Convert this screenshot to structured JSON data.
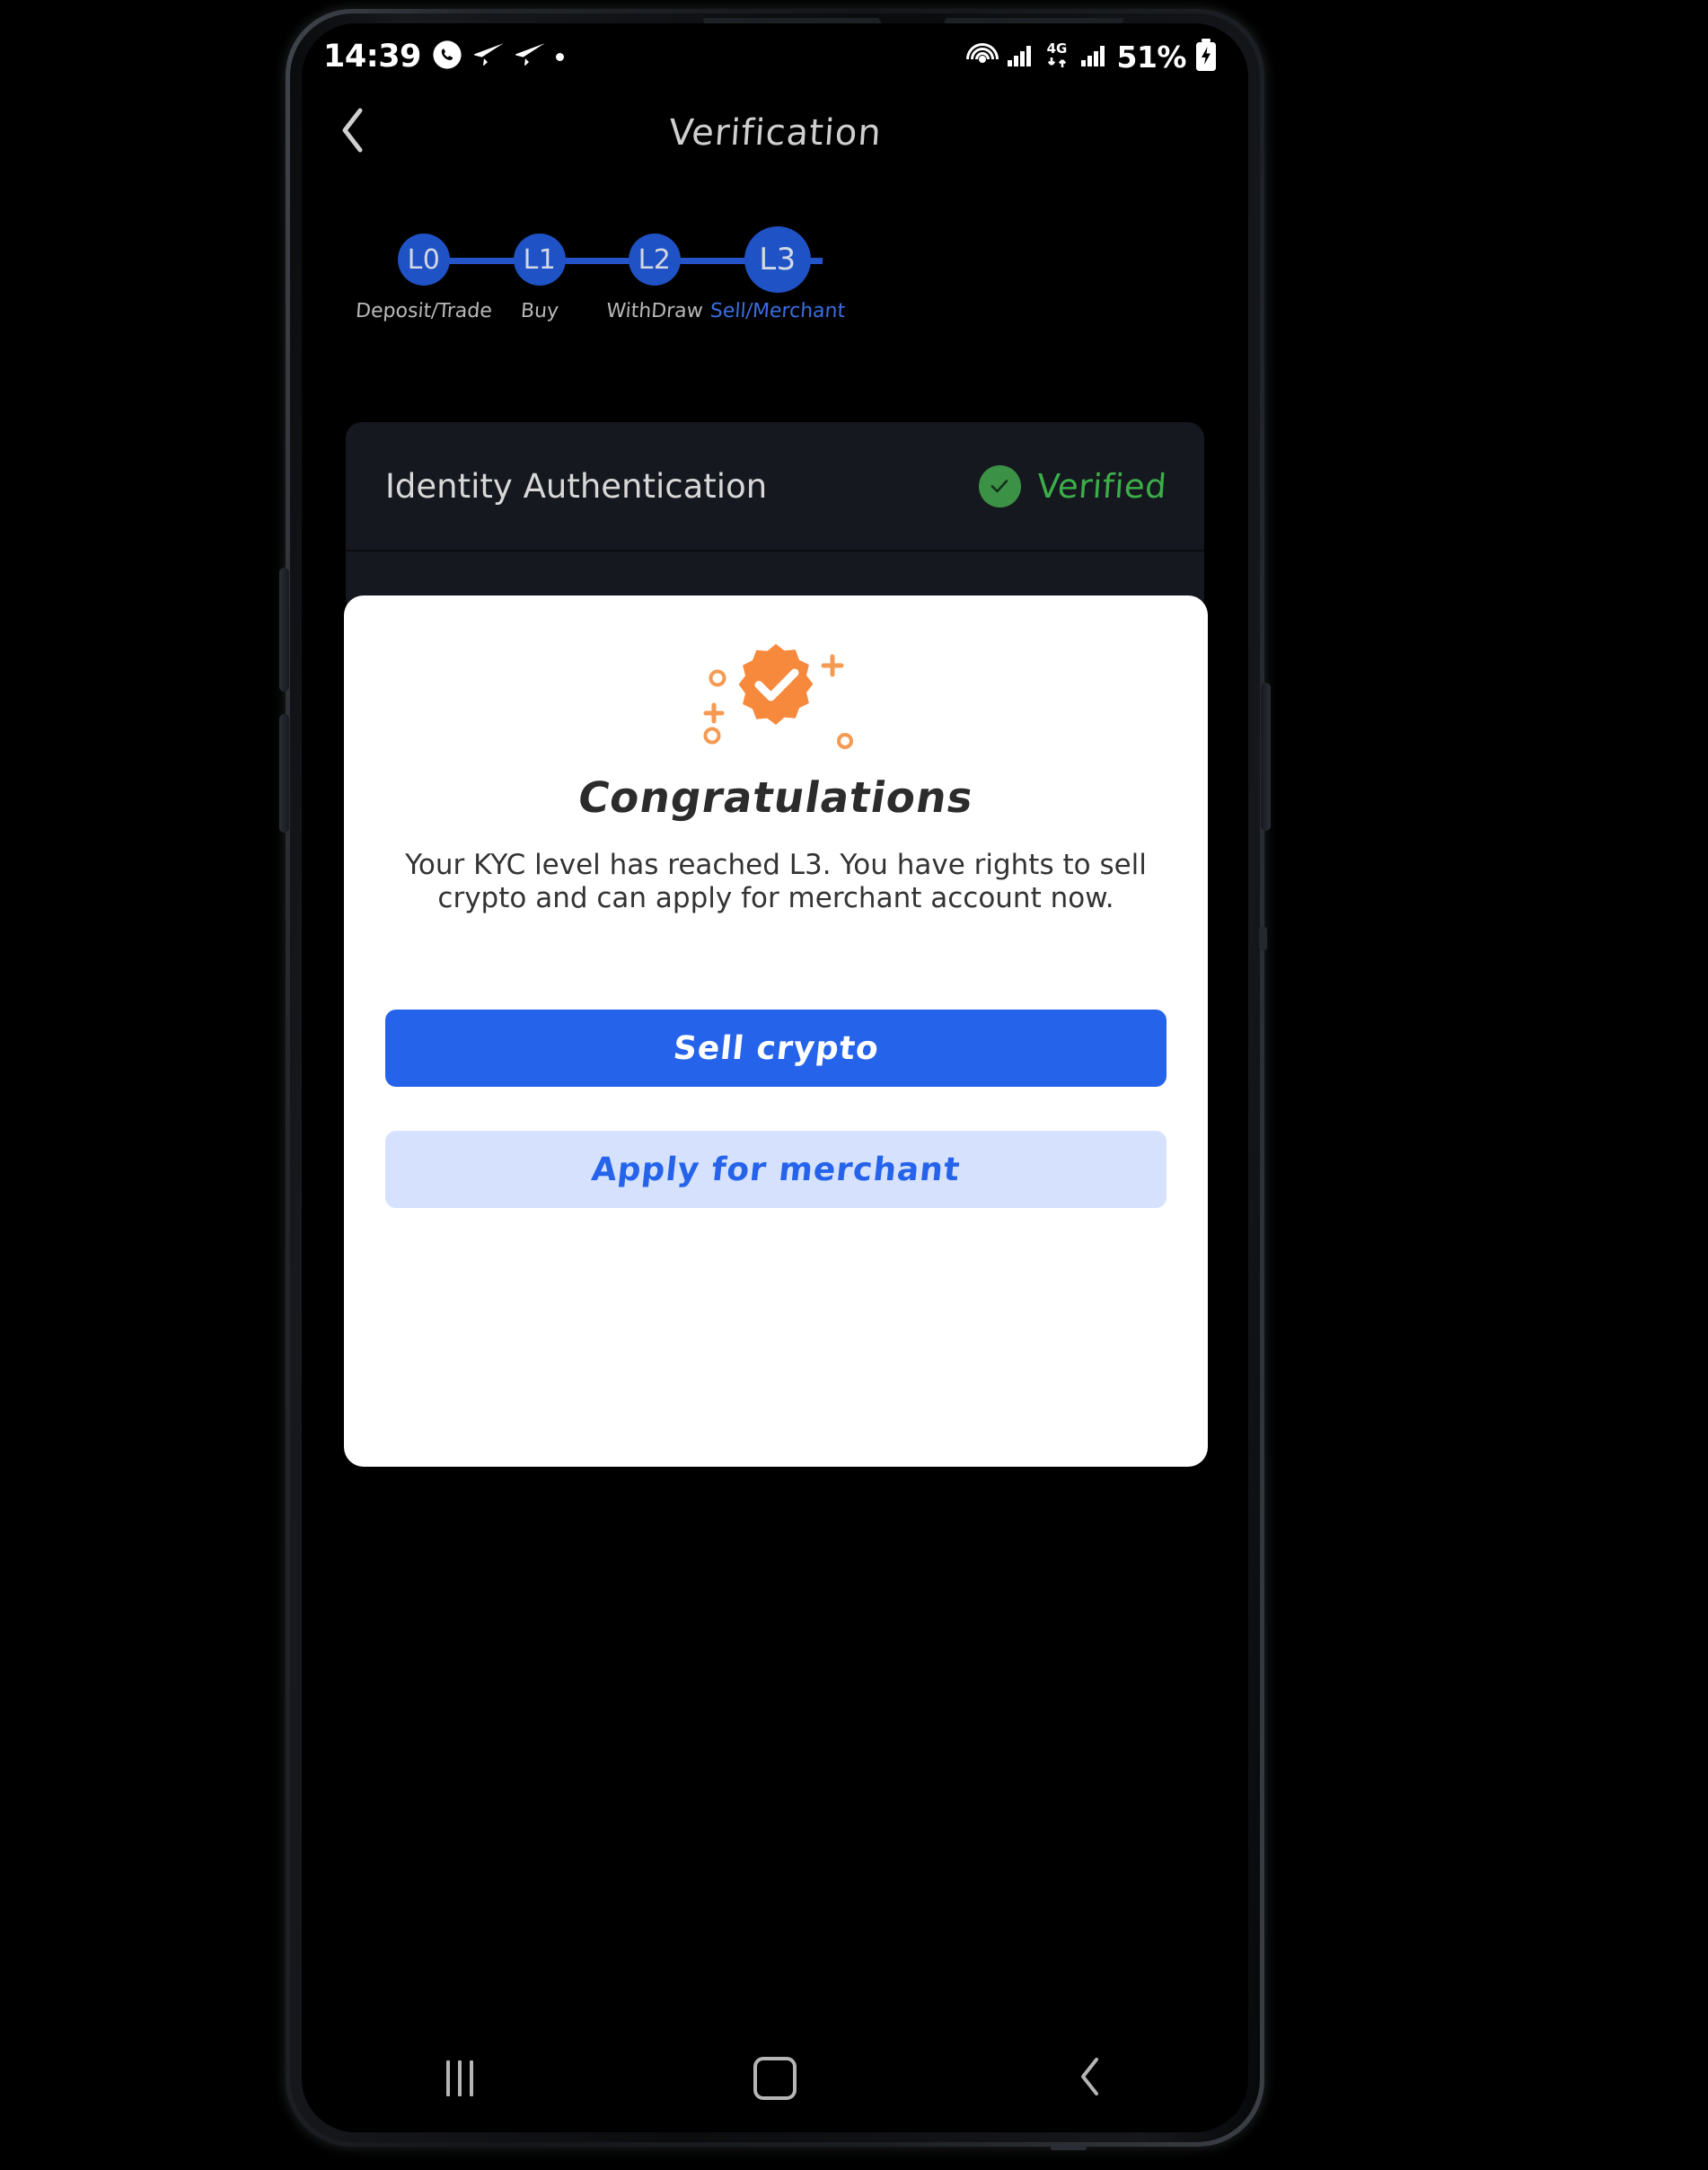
{
  "status_bar": {
    "time": "14:39",
    "left_icons": [
      "whatsapp-icon",
      "telegram-icon",
      "telegram-icon",
      "dot-icon"
    ],
    "right_icons": [
      "hotspot-icon",
      "signal-bars-icon",
      "4g-data-icon",
      "signal-bars-icon"
    ],
    "network_label": "4G",
    "battery_percent": "51%",
    "battery_icon": "battery-charging-icon"
  },
  "header": {
    "back_icon": "chevron-left-icon",
    "title": "Verification"
  },
  "stepper": {
    "steps": [
      {
        "code": "L0",
        "label": "Deposit/Trade",
        "active": false
      },
      {
        "code": "L1",
        "label": "Buy",
        "active": false
      },
      {
        "code": "L2",
        "label": "WithDraw",
        "active": false
      },
      {
        "code": "L3",
        "label": "Sell/Merchant",
        "active": true
      }
    ],
    "node_color": "#1f52c4",
    "line_color": "#2553c9",
    "active_label_color": "#3b6ee0"
  },
  "identity_card": {
    "title": "Identity Authentication",
    "status_text": "Verified",
    "status_icon": "check-circle-icon",
    "status_color": "#3cae49"
  },
  "dialog": {
    "badge_icon": "verified-badge-icon",
    "badge_color": "#f78e3d",
    "title": "Congratulations",
    "body": "Your KYC level has reached L3. You have rights to sell crypto and can apply for merchant account now.",
    "primary_button": {
      "label": "Sell crypto",
      "bg": "#2563eb",
      "text_color": "#ffffff"
    },
    "secondary_button": {
      "label": "Apply for merchant",
      "bg": "#d6e2fd",
      "text_color": "#2563eb"
    }
  },
  "nav_bar": {
    "recents_icon": "recents-icon",
    "home_icon": "home-icon",
    "back_icon": "nav-back-icon"
  }
}
